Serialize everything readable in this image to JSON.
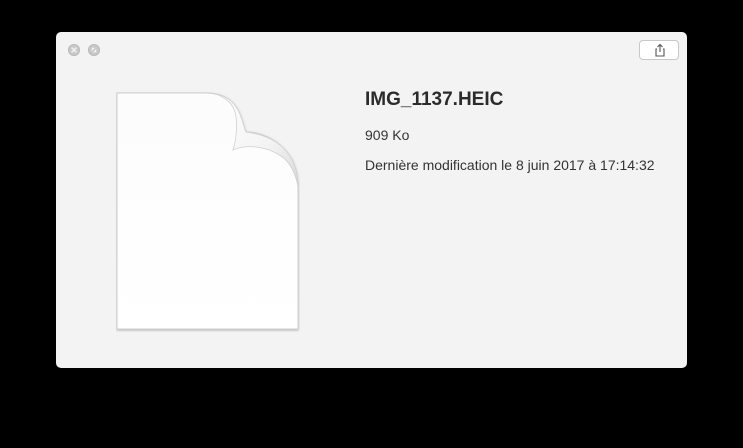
{
  "window": {
    "buttons": {
      "close_icon": "close-icon",
      "fullscreen_icon": "fullscreen-icon",
      "share_icon": "share-icon"
    }
  },
  "file": {
    "name": "IMG_1137.HEIC",
    "size": "909 Ko",
    "modified": "Dernière modification le 8 juin 2017 à 17:14:32",
    "icon": "generic-document-icon"
  },
  "colors": {
    "background": "#000000",
    "window": "#f3f3f3",
    "text": "#2b2b2b"
  }
}
